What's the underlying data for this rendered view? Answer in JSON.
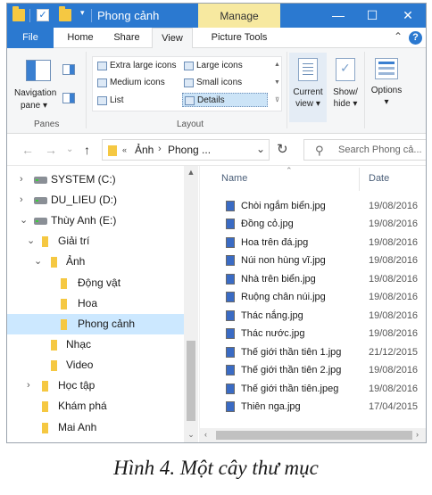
{
  "titlebar": {
    "title": "Phong cảnh",
    "manage_tab": "Manage",
    "dropdown": "▾",
    "minimize": "—",
    "maximize": "☐",
    "close": "✕"
  },
  "ribbon_tabs": [
    "File",
    "Home",
    "Share",
    "View",
    "Picture Tools"
  ],
  "active_tab": "View",
  "ribbon": {
    "panes": {
      "navigation_pane_label_1": "Navigation",
      "navigation_pane_label_2": "pane",
      "group_label": "Panes"
    },
    "layout": {
      "items": [
        {
          "label": "Extra large icons"
        },
        {
          "label": "Large icons"
        },
        {
          "label": "Medium icons"
        },
        {
          "label": "Small icons"
        },
        {
          "label": "List"
        },
        {
          "label": "Details",
          "selected": true
        }
      ],
      "group_label": "Layout"
    },
    "current_view": {
      "line1": "Current",
      "line2": "view"
    },
    "show_hide": {
      "line1": "Show/",
      "line2": "hide"
    },
    "options": {
      "label": "Options"
    }
  },
  "address": {
    "back": "←",
    "forward": "→",
    "up": "↑",
    "crumb_1": "Ảnh",
    "crumb_2": "Phong ...",
    "search_placeholder": "Search Phong cả..."
  },
  "nav_tree": [
    {
      "label": "SYSTEM (C:)",
      "type": "drive",
      "expander": "›"
    },
    {
      "label": "DU_LIEU (D:)",
      "type": "drive",
      "expander": "›"
    },
    {
      "label": "Thùy Anh (E:)",
      "type": "drive",
      "expander": "⌄"
    },
    {
      "label": "Giải trí",
      "type": "folder",
      "expander": "⌄"
    },
    {
      "label": "Ảnh",
      "type": "folder",
      "expander": "⌄"
    },
    {
      "label": "Động vật",
      "type": "folder",
      "expander": ""
    },
    {
      "label": "Hoa",
      "type": "folder",
      "expander": ""
    },
    {
      "label": "Phong cảnh",
      "type": "folder",
      "expander": "",
      "selected": true
    },
    {
      "label": "Nhạc",
      "type": "folder",
      "expander": ""
    },
    {
      "label": "Video",
      "type": "folder",
      "expander": ""
    },
    {
      "label": "Học tập",
      "type": "folder",
      "expander": "›"
    },
    {
      "label": "Khám phá",
      "type": "folder",
      "expander": ""
    },
    {
      "label": "Mai Anh",
      "type": "folder",
      "expander": ""
    }
  ],
  "file_list": {
    "headers": {
      "name": "Name",
      "date": "Date"
    },
    "rows": [
      {
        "name": "Chòi ngắm biển.jpg",
        "date": "19/08/2016"
      },
      {
        "name": "Đồng cỏ.jpg",
        "date": "19/08/2016"
      },
      {
        "name": "Hoa trên đá.jpg",
        "date": "19/08/2016"
      },
      {
        "name": "Núi non hùng vĩ.jpg",
        "date": "19/08/2016"
      },
      {
        "name": "Nhà trên biển.jpg",
        "date": "19/08/2016"
      },
      {
        "name": "Ruộng chân núi.jpg",
        "date": "19/08/2016"
      },
      {
        "name": "Thác nắng.jpg",
        "date": "19/08/2016"
      },
      {
        "name": "Thác nước.jpg",
        "date": "19/08/2016"
      },
      {
        "name": "Thế giới thần tiên 1.jpg",
        "date": "21/12/2015"
      },
      {
        "name": "Thế giới thần tiên 2.jpg",
        "date": "19/08/2016"
      },
      {
        "name": "Thế giới thần tiên.jpeg",
        "date": "19/08/2016"
      },
      {
        "name": "Thiên nga.jpg",
        "date": "17/04/2015"
      }
    ]
  },
  "caption": "Hình 4. Một cây thư mục"
}
